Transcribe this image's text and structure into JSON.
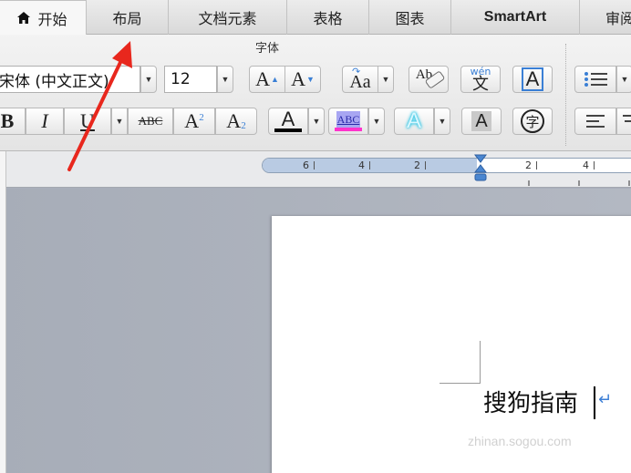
{
  "tabs": [
    {
      "label": "开始",
      "active": true
    },
    {
      "label": "布局"
    },
    {
      "label": "文档元素"
    },
    {
      "label": "表格"
    },
    {
      "label": "图表"
    },
    {
      "label": "SmartArt"
    },
    {
      "label": "审阅"
    }
  ],
  "ribbon": {
    "group_label": "字体",
    "font_name": "宋体 (中文正文)",
    "font_size": "12",
    "grow_label": "A",
    "shrink_label": "A",
    "change_case_label": "Aa",
    "clear_format_label": "Ab",
    "phonetic_top": "wén",
    "phonetic_bottom": "文",
    "char_border_label": "A",
    "bold_label": "B",
    "italic_label": "I",
    "underline_label": "U",
    "strike_label": "ABC",
    "superscript_base": "A",
    "superscript_mark": "2",
    "subscript_base": "A",
    "subscript_mark": "2",
    "font_color_label": "A",
    "highlight_label": "ABC",
    "text_effect_label": "A",
    "char_shading_label": "A",
    "enclose_label": "字",
    "font_color": "#000000",
    "highlight_color": "#ff33cc",
    "effect_color": "#37c8e6"
  },
  "ruler": {
    "ticks": [
      "6",
      "4",
      "2",
      "2",
      "4"
    ]
  },
  "document": {
    "text": "搜狗指南",
    "paragraph_mark": "↵",
    "watermark": "zhinan.sogou.com"
  },
  "annotation_color": "#e8271d"
}
